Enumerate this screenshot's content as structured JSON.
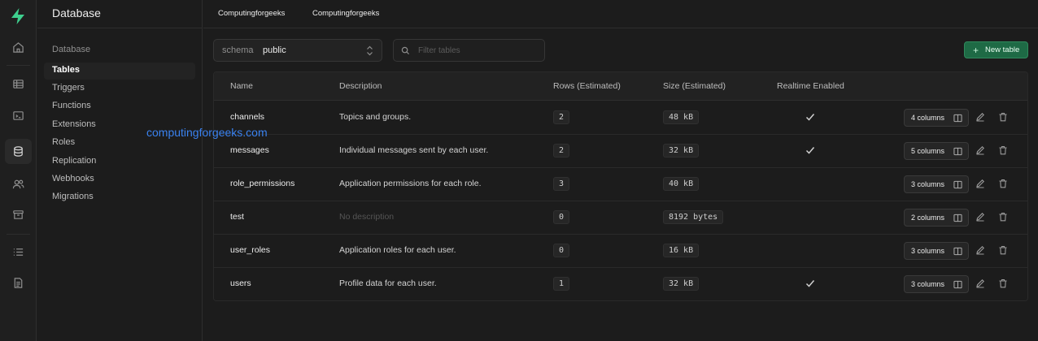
{
  "rail": {
    "icons": [
      "home-icon",
      "table-editor-icon",
      "sql-editor-icon",
      "database-icon",
      "users-icon",
      "storage-icon",
      "logs-icon",
      "docs-icon"
    ]
  },
  "menu": {
    "title": "Database",
    "section": "Database",
    "items": [
      "Tables",
      "Triggers",
      "Functions",
      "Extensions",
      "Roles",
      "Replication",
      "Webhooks",
      "Migrations"
    ]
  },
  "breadcrumb": {
    "org": "Computingforgeeks",
    "project": "Computingforgeeks"
  },
  "toolbar": {
    "schema_label": "schema",
    "schema_value": "public",
    "filter_placeholder": "Filter tables",
    "new_table_label": "New table"
  },
  "watermark": "computingforgeeks.com",
  "table": {
    "headers": [
      "Name",
      "Description",
      "Rows (Estimated)",
      "Size (Estimated)",
      "Realtime Enabled"
    ],
    "rows": [
      {
        "name": "channels",
        "description": "Topics and groups.",
        "rows": "2",
        "size": "48 kB",
        "realtime": true,
        "columns": "4 columns"
      },
      {
        "name": "messages",
        "description": "Individual messages sent by each user.",
        "rows": "2",
        "size": "32 kB",
        "realtime": true,
        "columns": "5 columns"
      },
      {
        "name": "role_permissions",
        "description": "Application permissions for each role.",
        "rows": "3",
        "size": "40 kB",
        "realtime": false,
        "columns": "3 columns"
      },
      {
        "name": "test",
        "description": "No description",
        "rows": "0",
        "size": "8192 bytes",
        "realtime": false,
        "columns": "2 columns"
      },
      {
        "name": "user_roles",
        "description": "Application roles for each user.",
        "rows": "0",
        "size": "16 kB",
        "realtime": false,
        "columns": "3 columns"
      },
      {
        "name": "users",
        "description": "Profile data for each user.",
        "rows": "1",
        "size": "32 kB",
        "realtime": true,
        "columns": "3 columns"
      }
    ]
  },
  "colors": {
    "accent_green": "#3ecf8e",
    "button_green": "#1e6a45",
    "watermark_blue": "#3a82f0",
    "background": "#1c1c1c"
  }
}
